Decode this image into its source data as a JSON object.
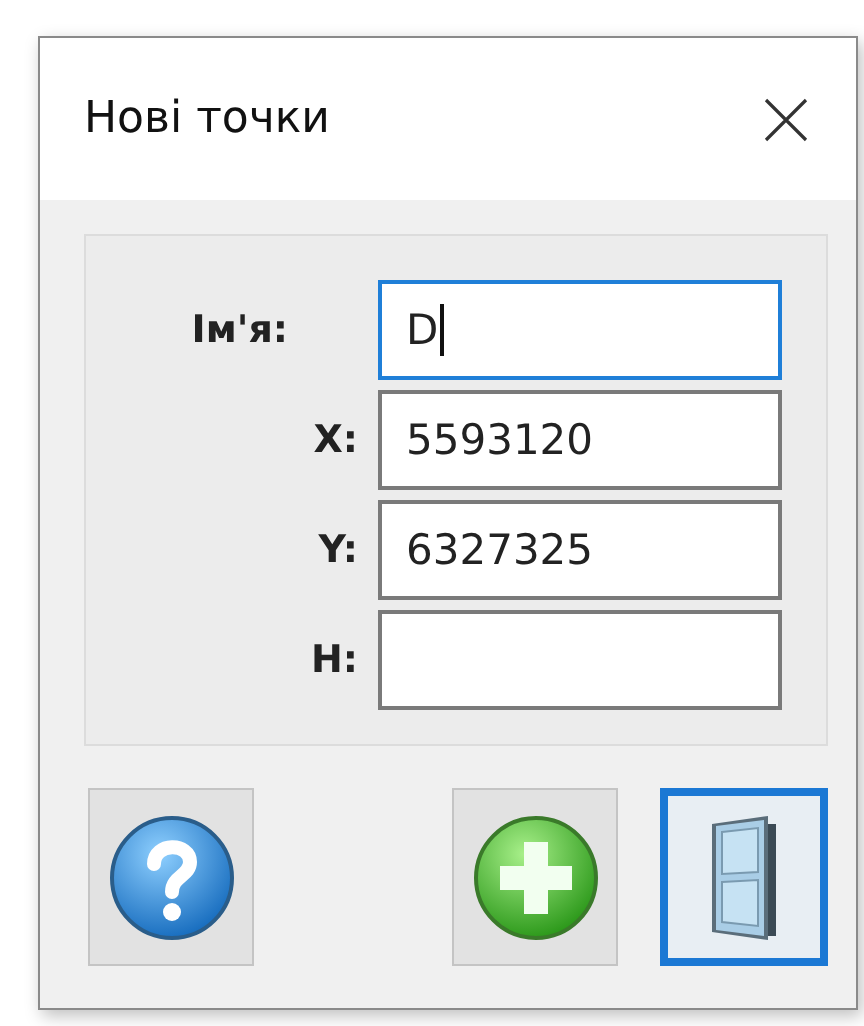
{
  "window": {
    "title": "Нові точки"
  },
  "fields": [
    {
      "label": "Ім'я:",
      "value": "D",
      "focused": true
    },
    {
      "label": "X:",
      "value": "5593120",
      "focused": false
    },
    {
      "label": "Y:",
      "value": "6327325",
      "focused": false
    },
    {
      "label": "H:",
      "focused": false
    }
  ],
  "buttons": [
    {
      "kind": "help",
      "focused": false
    },
    {
      "kind": "add",
      "focused": false
    },
    {
      "kind": "exit",
      "focused": true
    }
  ]
}
